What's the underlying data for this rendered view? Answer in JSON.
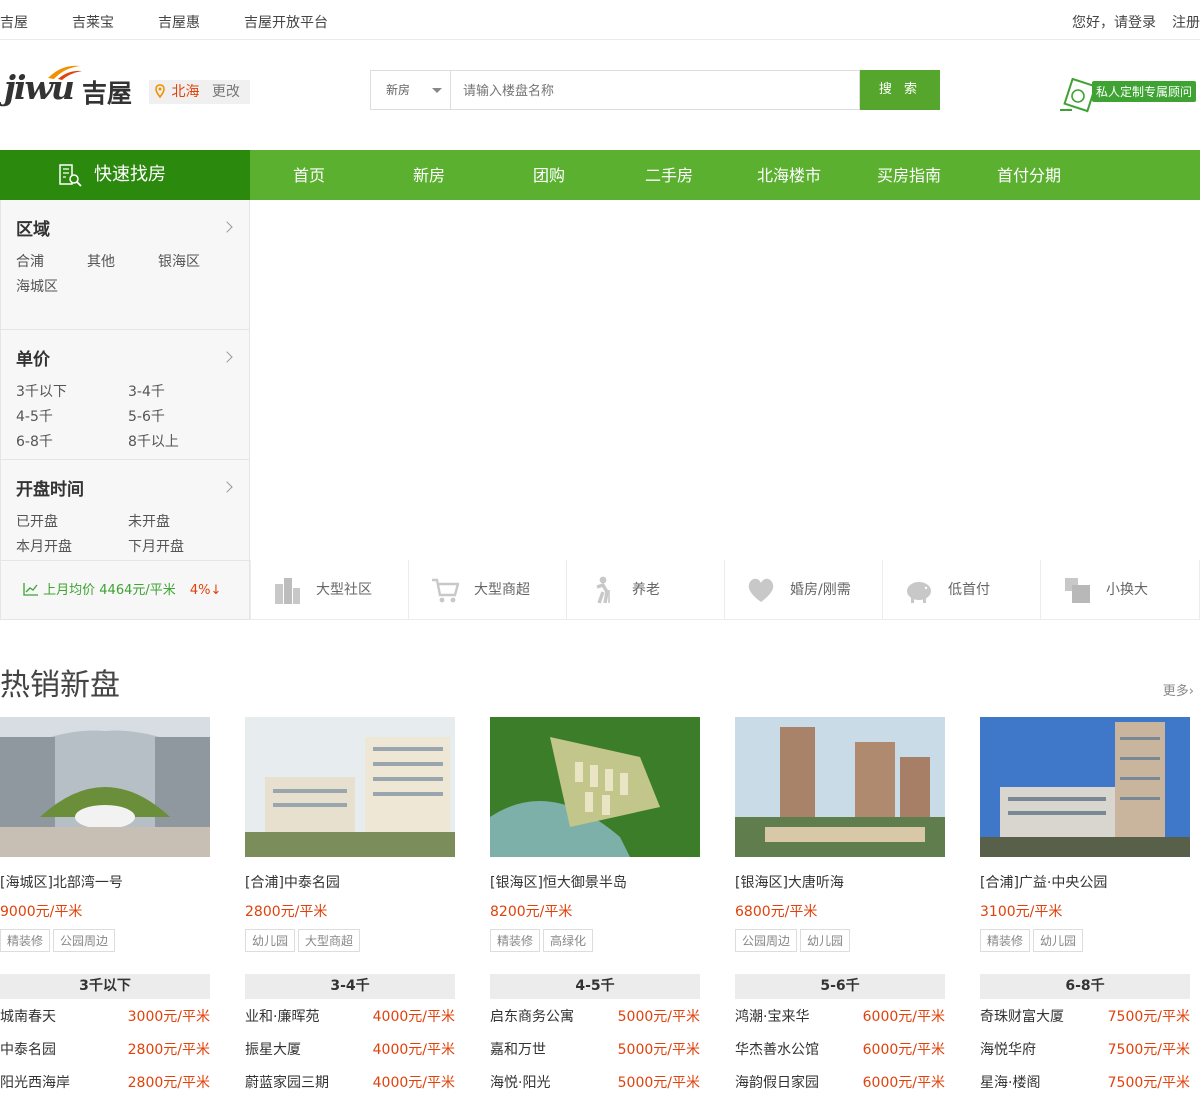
{
  "topbar": {
    "links": [
      "吉屋",
      "吉莱宝",
      "吉屋惠",
      "吉屋开放平台"
    ],
    "greeting": "您好，请登录",
    "register": "注册"
  },
  "header": {
    "logo_text": "jiwu",
    "logo_cn": "吉屋",
    "city": "北海",
    "change": "更改",
    "search": {
      "type": "新房",
      "placeholder": "请输入楼盘名称",
      "button": "搜 索"
    },
    "custom_label": "私人定制专属顾问"
  },
  "nav": {
    "quick": "快速找房",
    "items": [
      "首页",
      "新房",
      "团购",
      "二手房",
      "北海楼市",
      "买房指南",
      "首付分期"
    ]
  },
  "sidebar": {
    "region": {
      "title": "区域",
      "options": [
        "合浦",
        "其他",
        "银海区",
        "海城区"
      ]
    },
    "price": {
      "title": "单价",
      "options": [
        "3千以下",
        "3-4千",
        "4-5千",
        "5-6千",
        "6-8千",
        "8千以上"
      ]
    },
    "opening": {
      "title": "开盘时间",
      "options": [
        "已开盘",
        "未开盘",
        "本月开盘",
        "下月开盘"
      ]
    },
    "avg_label": "上月均价 4464元/平米",
    "avg_change": "4%↓"
  },
  "features": [
    "大型社区",
    "大型商超",
    "养老",
    "婚房/刚需",
    "低首付",
    "小换大"
  ],
  "hot": {
    "title": "热销新盘",
    "more": "更多",
    "cards": [
      {
        "name": "[海城区]北部湾一号",
        "price": "9000元/平米",
        "tags": [
          "精装修",
          "公园周边"
        ]
      },
      {
        "name": "[合浦]中泰名园",
        "price": "2800元/平米",
        "tags": [
          "幼儿园",
          "大型商超"
        ]
      },
      {
        "name": "[银海区]恒大御景半岛",
        "price": "8200元/平米",
        "tags": [
          "精装修",
          "高绿化"
        ]
      },
      {
        "name": "[银海区]大唐听海",
        "price": "6800元/平米",
        "tags": [
          "公园周边",
          "幼儿园"
        ]
      },
      {
        "name": "[合浦]广益·中央公园",
        "price": "3100元/平米",
        "tags": [
          "精装修",
          "幼儿园"
        ]
      }
    ]
  },
  "price_lists": [
    {
      "range": "3千以下",
      "rows": [
        {
          "name": "城南春天",
          "price": "3000元/平米"
        },
        {
          "name": "中泰名园",
          "price": "2800元/平米"
        },
        {
          "name": "阳光西海岸",
          "price": "2800元/平米"
        }
      ]
    },
    {
      "range": "3-4千",
      "rows": [
        {
          "name": "业和·廉晖苑",
          "price": "4000元/平米"
        },
        {
          "name": "振星大厦",
          "price": "4000元/平米"
        },
        {
          "name": "蔚蓝家园三期",
          "price": "4000元/平米"
        }
      ]
    },
    {
      "range": "4-5千",
      "rows": [
        {
          "name": "启东商务公寓",
          "price": "5000元/平米"
        },
        {
          "name": "嘉和万世",
          "price": "5000元/平米"
        },
        {
          "name": "海悦·阳光",
          "price": "5000元/平米"
        }
      ]
    },
    {
      "range": "5-6千",
      "rows": [
        {
          "name": "鸿潮·宝来华",
          "price": "6000元/平米"
        },
        {
          "name": "华杰善水公馆",
          "price": "6000元/平米"
        },
        {
          "name": "海韵假日家园",
          "price": "6000元/平米"
        }
      ]
    },
    {
      "range": "6-8千",
      "rows": [
        {
          "name": "奇珠财富大厦",
          "price": "7500元/平米"
        },
        {
          "name": "海悦华府",
          "price": "7500元/平米"
        },
        {
          "name": "星海·楼阁",
          "price": "7500元/平米"
        }
      ]
    }
  ]
}
